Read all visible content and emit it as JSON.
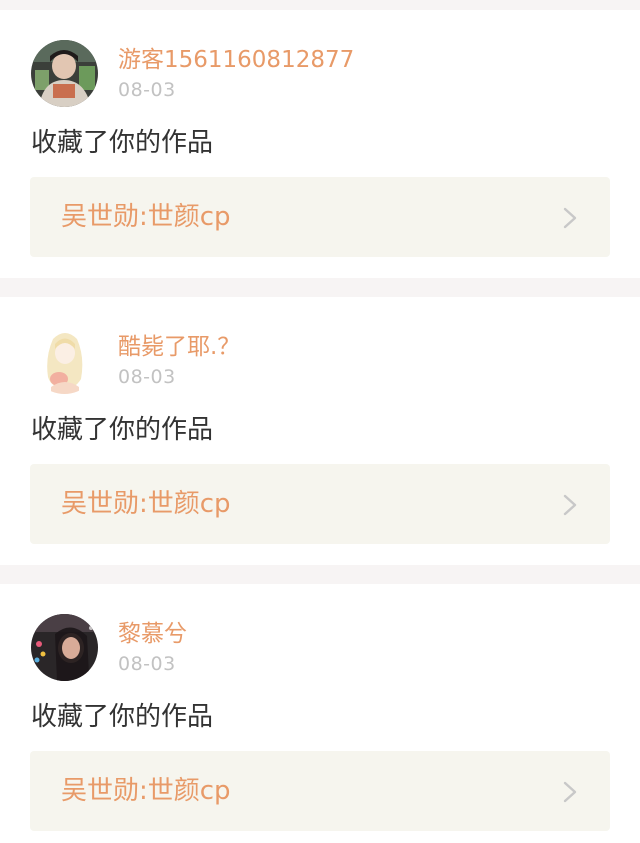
{
  "notifications": [
    {
      "username": "游客1561160812877",
      "time": "08-03",
      "action": "收藏了你的作品",
      "work_title": "吴世勋:世颜cp"
    },
    {
      "username": "酷毙了耶.？",
      "time": "08-03",
      "action": "收藏了你的作品",
      "work_title": "吴世勋:世颜cp"
    },
    {
      "username": "黎慕兮",
      "time": "08-03",
      "action": "收藏了你的作品",
      "work_title": "吴世勋:世颜cp"
    }
  ],
  "colors": {
    "accent": "#e89a68",
    "muted": "#c2c2c2",
    "text": "#333333",
    "link_bg": "#f6f5ee",
    "page_bg": "#f7f4f4"
  },
  "icons": {
    "link_arrow": "chevron-right-icon"
  }
}
